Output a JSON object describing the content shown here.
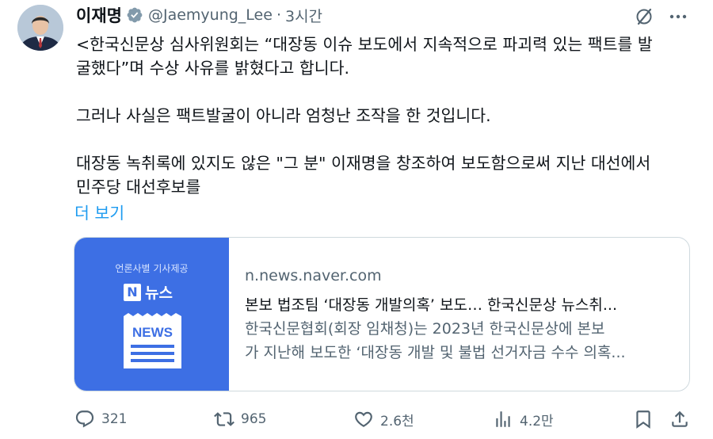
{
  "tweet": {
    "display_name": "이재명",
    "handle": "@Jaemyung_Lee",
    "separator": "·",
    "time": "3시간",
    "lines": [
      "<한국신문상 심사위원회는 “대장동 이슈 보도에서 지속적으로 파괴력 있는 팩트를 발",
      "굴했다”며 수상 사유를 밝혔다고 합니다.",
      "",
      "그러나 사실은 팩트발굴이 아니라 엄청난 조작을 한 것입니다.",
      "",
      "대장동 녹취록에 있지도 않은 \"그 분\" 이재명을 창조하여 보도함으로써 지난 대선에서",
      "민주당 대선후보를"
    ],
    "show_more": "더 보기"
  },
  "card": {
    "thumb_caption": "언론사별 기사제공",
    "thumb_logo_letter": "N",
    "thumb_logo_text": "뉴스",
    "thumb_paper_label": "NEWS",
    "domain": "n.news.naver.com",
    "title": "본보 법조팀 ‘대장동 개발의혹’ 보도… 한국신문상 뉴스취...",
    "desc_line1": "한국신문협회(회장 임채청)는 2023년 한국신문상에 본보",
    "desc_line2": "가 지난해 보도한 ‘대장동 개발 및 불법 선거자금 수수 의혹..."
  },
  "actions": {
    "replies": "321",
    "reposts": "965",
    "likes": "2.6천",
    "views": "4.2만"
  },
  "colors": {
    "text": "#0f1419",
    "secondary": "#536471",
    "link": "#1d9bf0",
    "verified": "#829aab",
    "card_thumb": "#3d6fe4"
  },
  "icons": {
    "verified": "verified-badge-icon",
    "grok": "grok-icon",
    "more": "more-icon",
    "reply": "reply-icon",
    "repost": "repost-icon",
    "like": "like-icon",
    "views": "views-icon",
    "bookmark": "bookmark-icon",
    "share": "share-icon"
  }
}
